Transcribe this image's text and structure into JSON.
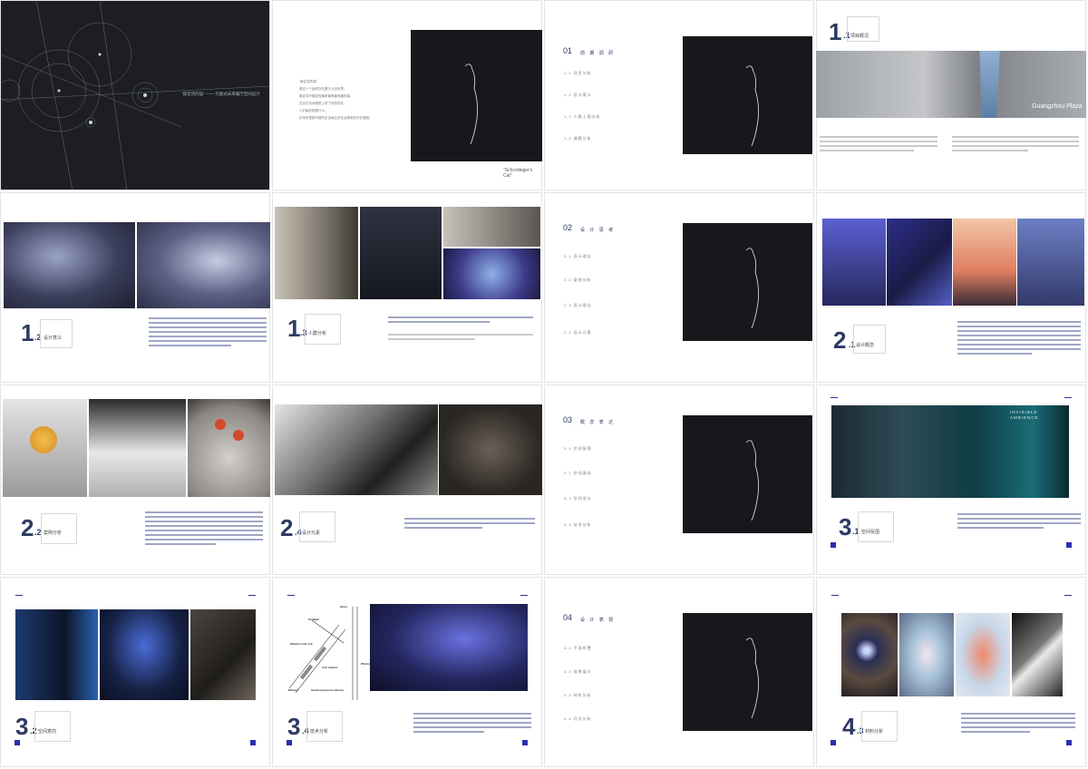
{
  "cover": {
    "tagline": "\"薛定谔的猫\" —— 元素式未来餐厅空间设计"
  },
  "intro": {
    "poem": [
      "\"薛定谔的猫\"",
      "是这一个始终存在着于认识世界，",
      "薛定谔不确定性最新最美最有趣的事，",
      "无论在未来都是上帝了你的存在，",
      "人们每秒都是什么，",
      "在未来里都可能所走也每应该互此精彩的存在道路。"
    ],
    "caption": "\"Schrodinger's Cat\""
  },
  "hero": {
    "caption": "Guangzhou Plaza"
  },
  "sections": [
    {
      "num": "1",
      "sub": ".2",
      "cn": "设计意义"
    },
    {
      "num": "1",
      "sub": ".3",
      "cn": "人群分析"
    },
    {
      "num": "2",
      "sub": ".1",
      "cn": "设计概念"
    },
    {
      "num": "2",
      "sub": ".2",
      "cn": "案例分析"
    },
    {
      "num": "2",
      "sub": ".4",
      "cn": "设计元素"
    },
    {
      "num": "3",
      "sub": ".1",
      "cn": "空间氛围"
    },
    {
      "num": "3",
      "sub": ".2",
      "cn": "空间意向"
    },
    {
      "num": "3",
      "sub": ".4",
      "cn": "技术分析"
    },
    {
      "num": "4",
      "sub": ".3",
      "cn": "材料分析"
    },
    {
      "num": "1",
      "sub": ".1",
      "cn": "项目概况"
    }
  ],
  "tocs": [
    {
      "num": "01",
      "head": "前 期 调 研",
      "rows": [
        "1.1 项目分析",
        "1.2 设计意义",
        "1.3 人群上图分析",
        "1.4 课题分析"
      ]
    },
    {
      "num": "02",
      "head": "设 计 思 考",
      "rows": [
        "2.1 设计理念",
        "2.2 案例分析",
        "2.3 设计理念",
        "2.4 设计元素"
      ]
    },
    {
      "num": "03",
      "head": "概 念 表 达",
      "rows": [
        "3.1 空间氛围",
        "3.2 空间意向",
        "3.3 空间设计",
        "3.4 技术分析"
      ]
    },
    {
      "num": "04",
      "head": "设 计 表 现",
      "rows": [
        "4.1 平面布置",
        "4.2 效果展示",
        "4.3 材料分析",
        "4.4 灯光分析"
      ]
    }
  ],
  "labels": {
    "invisible": "INVISIBLE AMBIENCE",
    "diagram": [
      "Glass",
      "Sunlight",
      "Bifacial solar cell",
      "Cell shadow",
      "Bifacial",
      "Semitransparent reflector",
      "Window"
    ]
  }
}
